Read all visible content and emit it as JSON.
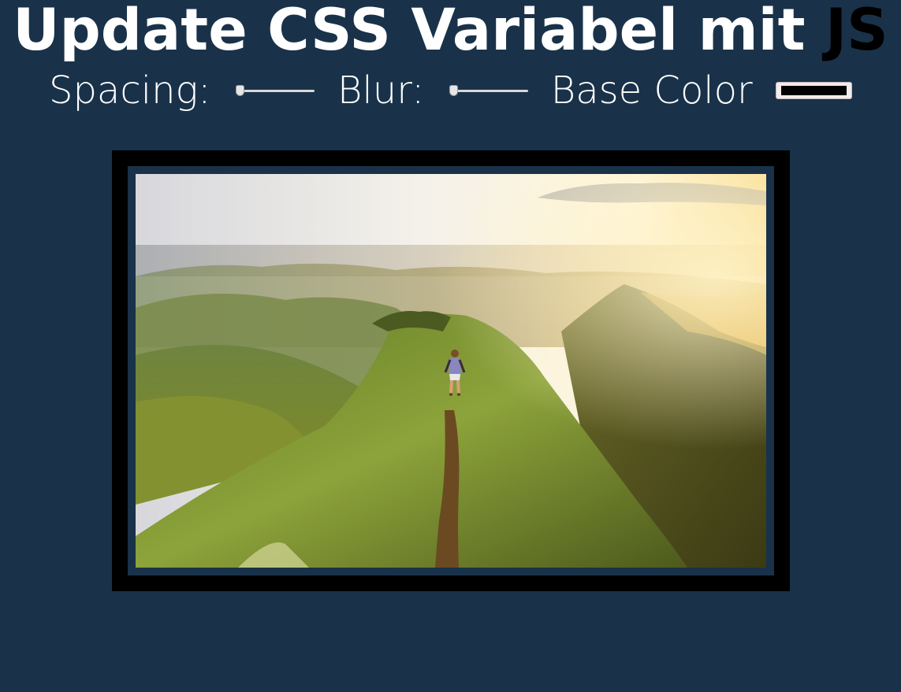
{
  "header": {
    "title_main": "Update CSS Variabel mit ",
    "title_highlight": "JS"
  },
  "controls": {
    "spacing_label": "Spacing:",
    "spacing_value": 0,
    "blur_label": "Blur:",
    "blur_value": 0,
    "base_color_label": "Base Color",
    "base_color_value": "#000000"
  },
  "image": {
    "subject": "hiker-on-mountain-ridge-at-sunrise"
  },
  "colors": {
    "background": "#193249",
    "highlight": "#000000",
    "text": "#ffffff"
  }
}
